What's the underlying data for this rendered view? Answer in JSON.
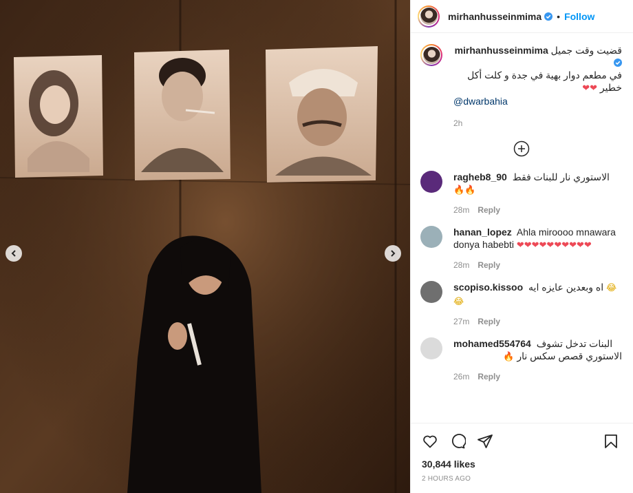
{
  "post": {
    "author": "mirhanhusseinmima",
    "separator": "•",
    "follow_label": "Follow"
  },
  "caption": {
    "username": "mirhanhusseinmima",
    "line1": "قضيت وقت جميل",
    "line2": "في مطعم دوار بهية في جدة و كلت أكل",
    "line3": "خطير",
    "line3_emoji": "❤❤",
    "mention": "@dwarbahia",
    "time": "2h"
  },
  "comments": [
    {
      "username": "ragheb8_90",
      "text": "الاستوري نار للبنات فقط",
      "emoji": "🔥🔥",
      "time": "28m",
      "reply_label": "Reply",
      "avatar_color": "#5a2a7a"
    },
    {
      "username": "hanan_lopez",
      "text": "Ahla miroooo mnawara donya habebti",
      "emoji": "❤❤❤❤❤❤❤❤❤❤",
      "time": "28m",
      "reply_label": "Reply",
      "avatar_color": "#9bb0b8"
    },
    {
      "username": "scopiso.kissoo",
      "text": "اه وبعدين عايزه ايه",
      "emoji": "😂😂",
      "time": "27m",
      "reply_label": "Reply",
      "avatar_color": "#6f6f6f"
    },
    {
      "username": "mohamed554764",
      "text": "البنات تدخل تشوف",
      "text2": "الاستوري قصص سكس نار",
      "emoji": "🔥",
      "time": "26m",
      "reply_label": "Reply",
      "avatar_color": "#dbdbdb"
    }
  ],
  "likes": "30,844 likes",
  "posted": "2 HOURS AGO",
  "icons": {
    "verified": "verified-badge-icon",
    "like": "heart-icon",
    "comment": "comment-bubble-icon",
    "share": "paper-plane-icon",
    "save": "bookmark-icon",
    "load_more": "plus-circle-icon",
    "prev": "chevron-left-icon",
    "next": "chevron-right-icon"
  },
  "colors": {
    "link": "#0095f6",
    "mention": "#00376b",
    "muted": "#8e8e8e",
    "heart": "#ed4956"
  }
}
